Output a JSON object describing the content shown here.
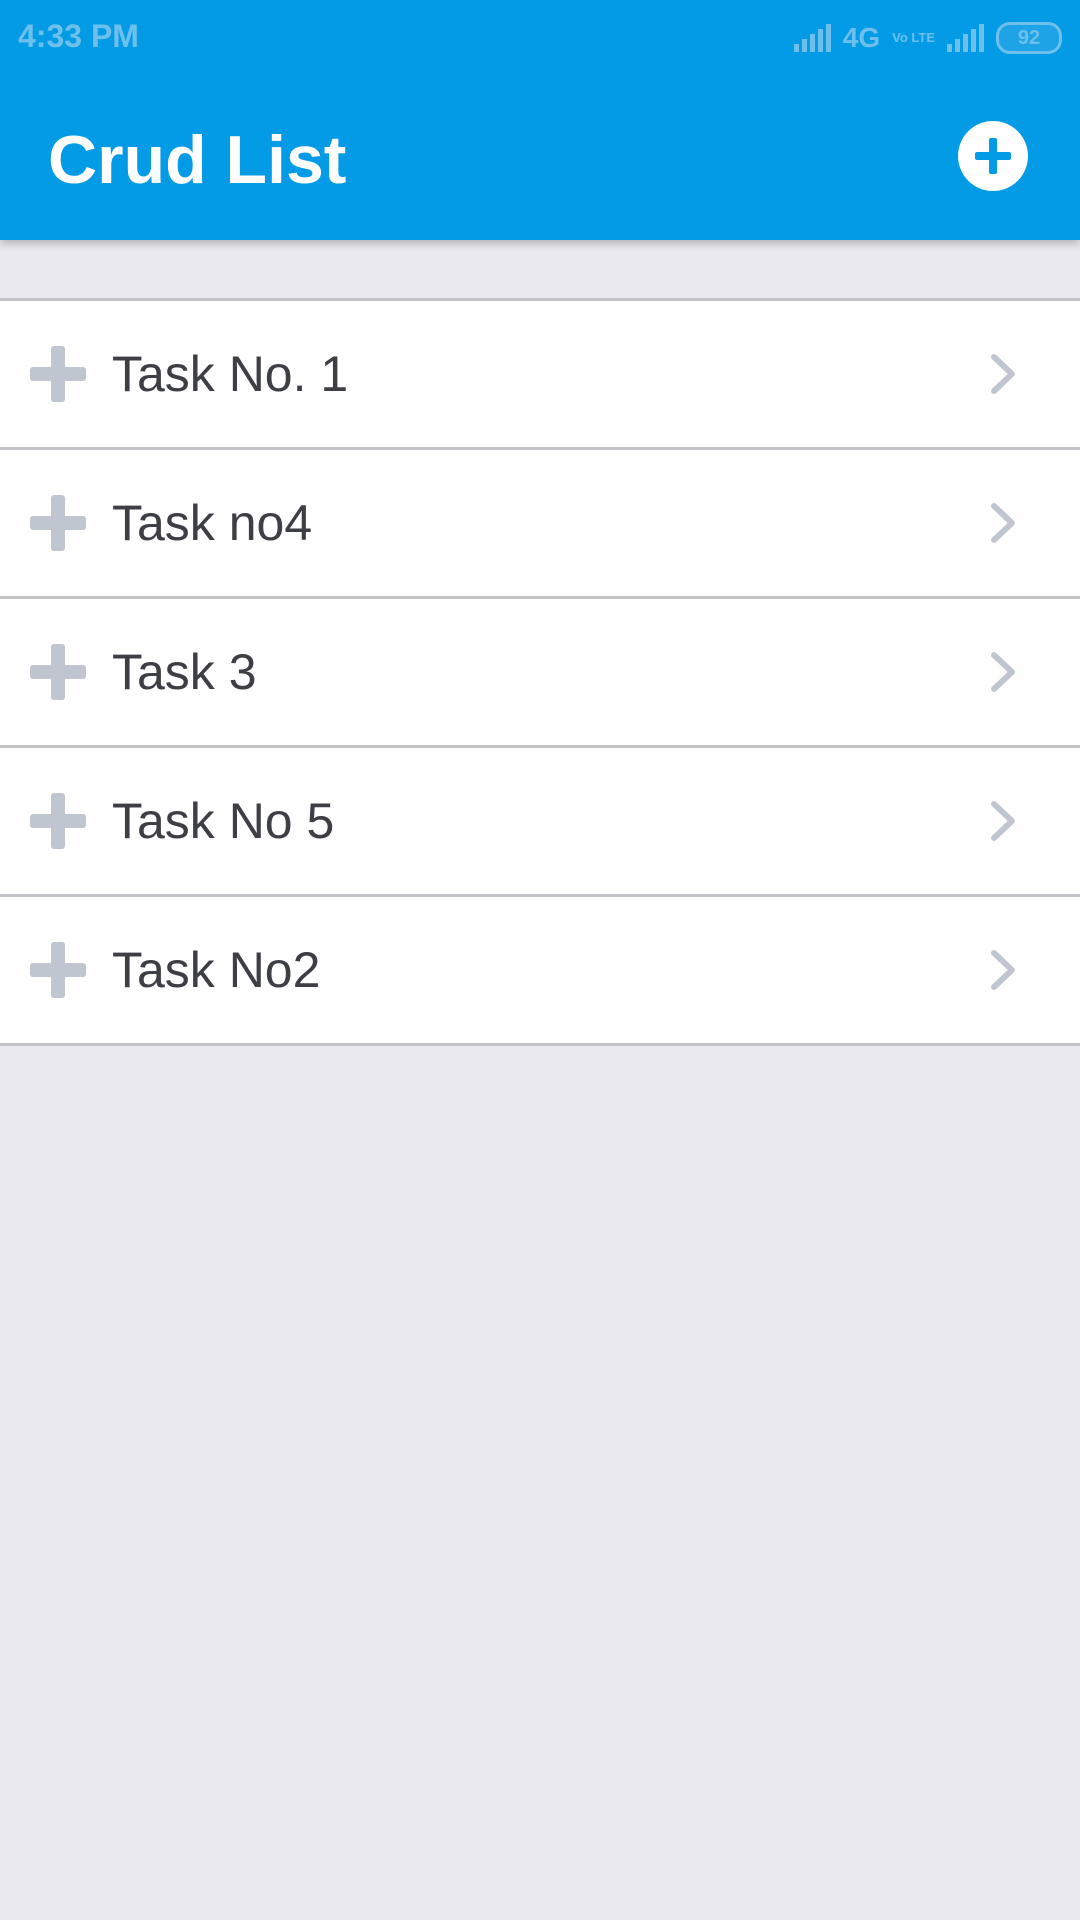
{
  "status_bar": {
    "time": "4:33 PM",
    "network": "4G",
    "volte": "Vo LTE",
    "battery": "92"
  },
  "header": {
    "title": "Crud List",
    "add_icon": "plus-circle-icon"
  },
  "tasks": [
    {
      "label": "Task No. 1",
      "icon": "plus-icon",
      "action_icon": "chevron-right-icon"
    },
    {
      "label": "Task no4",
      "icon": "plus-icon",
      "action_icon": "chevron-right-icon"
    },
    {
      "label": "Task 3",
      "icon": "plus-icon",
      "action_icon": "chevron-right-icon"
    },
    {
      "label": "Task No 5",
      "icon": "plus-icon",
      "action_icon": "chevron-right-icon"
    },
    {
      "label": "Task No2",
      "icon": "plus-icon",
      "action_icon": "chevron-right-icon"
    }
  ],
  "colors": {
    "app_bar": "#039be5",
    "background": "#e9e9ef",
    "icon_gray": "#c0c6cf",
    "text": "#3d3f44"
  }
}
